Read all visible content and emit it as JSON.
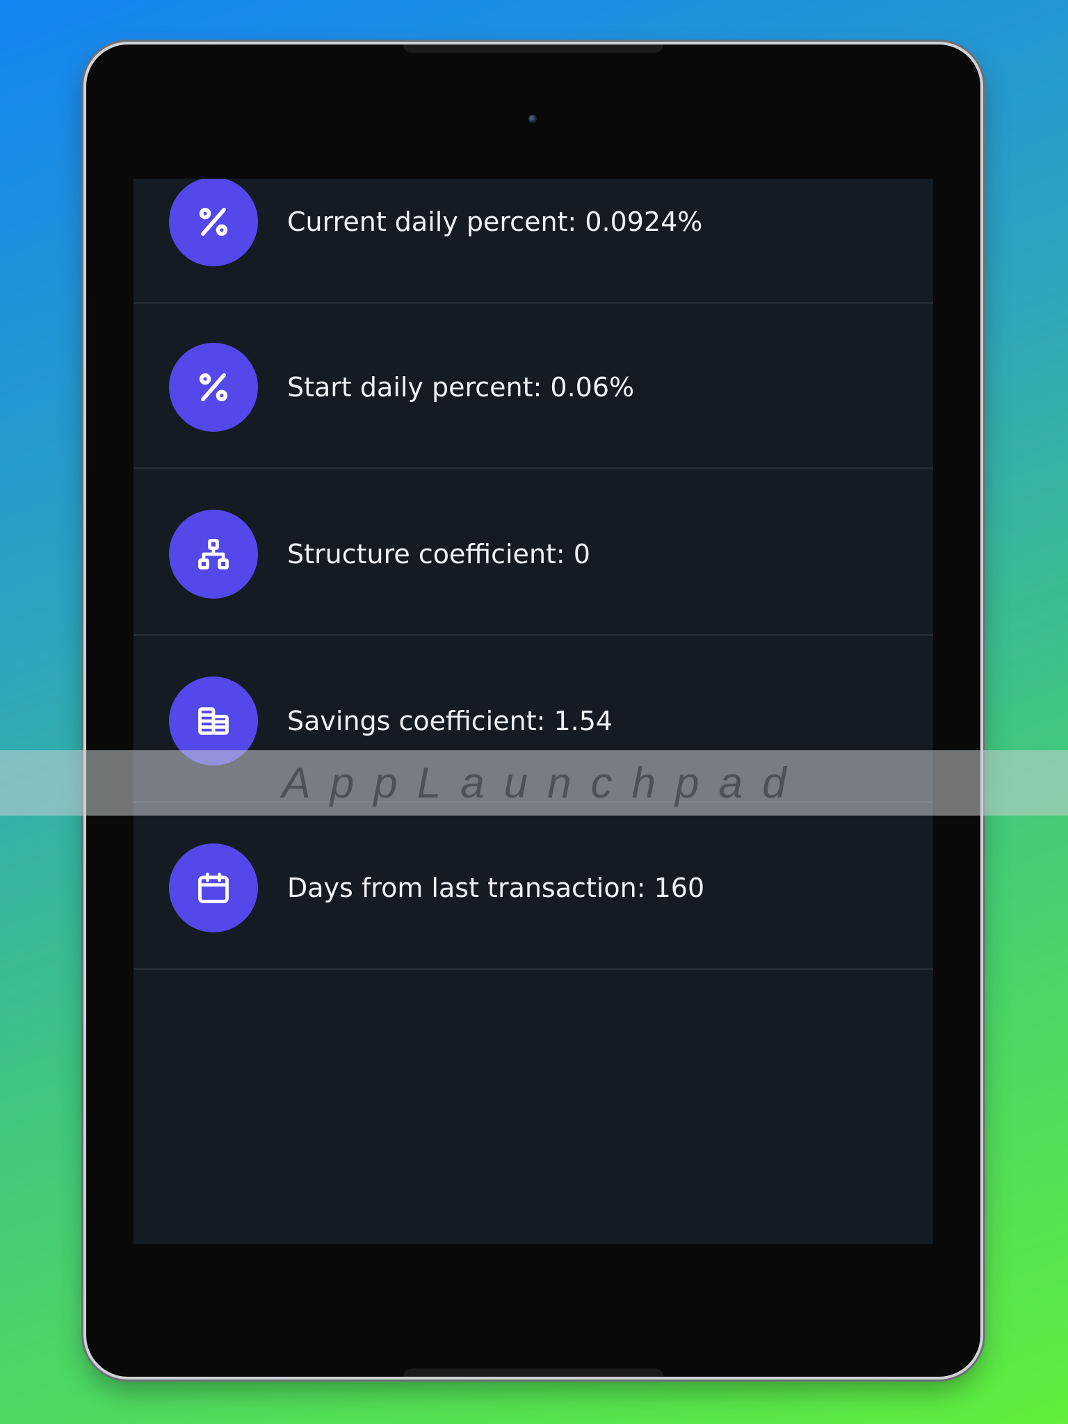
{
  "background": {
    "gradient_start": "#1684f2",
    "gradient_end": "#5fef3c"
  },
  "colors": {
    "screen_bg": "#151b23",
    "icon_circle": "#5448ea",
    "divider": "#232b35",
    "text": "#eef1f5"
  },
  "list": {
    "items": [
      {
        "icon": "percent-icon",
        "label": "Current daily percent: 0.0924%"
      },
      {
        "icon": "percent-icon",
        "label": "Start daily percent: 0.06%"
      },
      {
        "icon": "hierarchy-icon",
        "label": "Structure coefficient: 0"
      },
      {
        "icon": "coins-icon",
        "label": "Savings coefficient: 1.54"
      },
      {
        "icon": "calendar-icon",
        "label": "Days from last transaction: 160"
      }
    ]
  },
  "watermark": {
    "text": "AppLaunchpad"
  }
}
